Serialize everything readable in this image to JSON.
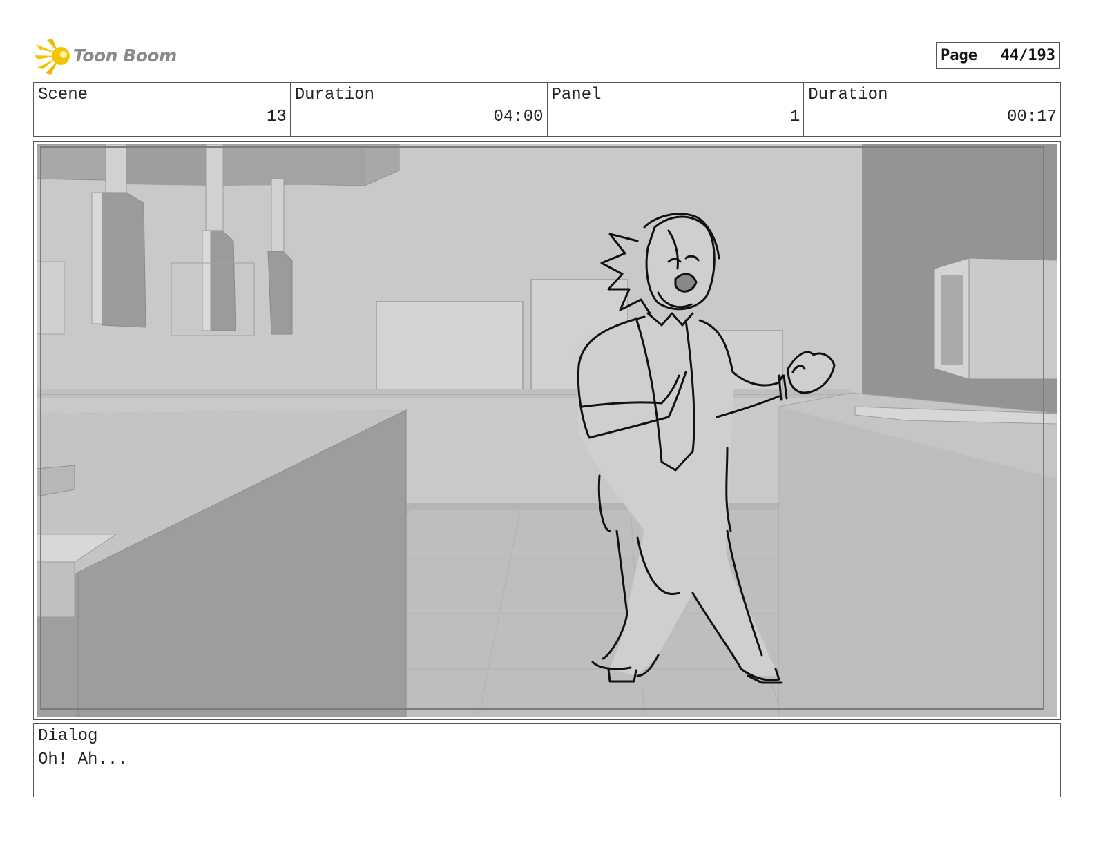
{
  "header": {
    "logo_text": "Toon Boom",
    "page_label": "Page",
    "page_value": "44/193"
  },
  "info": {
    "scene_label": "Scene",
    "scene_value": "13",
    "scene_duration_label": "Duration",
    "scene_duration_value": "04:00",
    "panel_label": "Panel",
    "panel_value": "1",
    "panel_duration_label": "Duration",
    "panel_duration_value": "00:17"
  },
  "dialog": {
    "label": "Dialog",
    "text": "Oh! Ah..."
  },
  "colors": {
    "logo_yellow": "#f5c400",
    "logo_text": "#8a8a8a",
    "border": "#555555"
  }
}
